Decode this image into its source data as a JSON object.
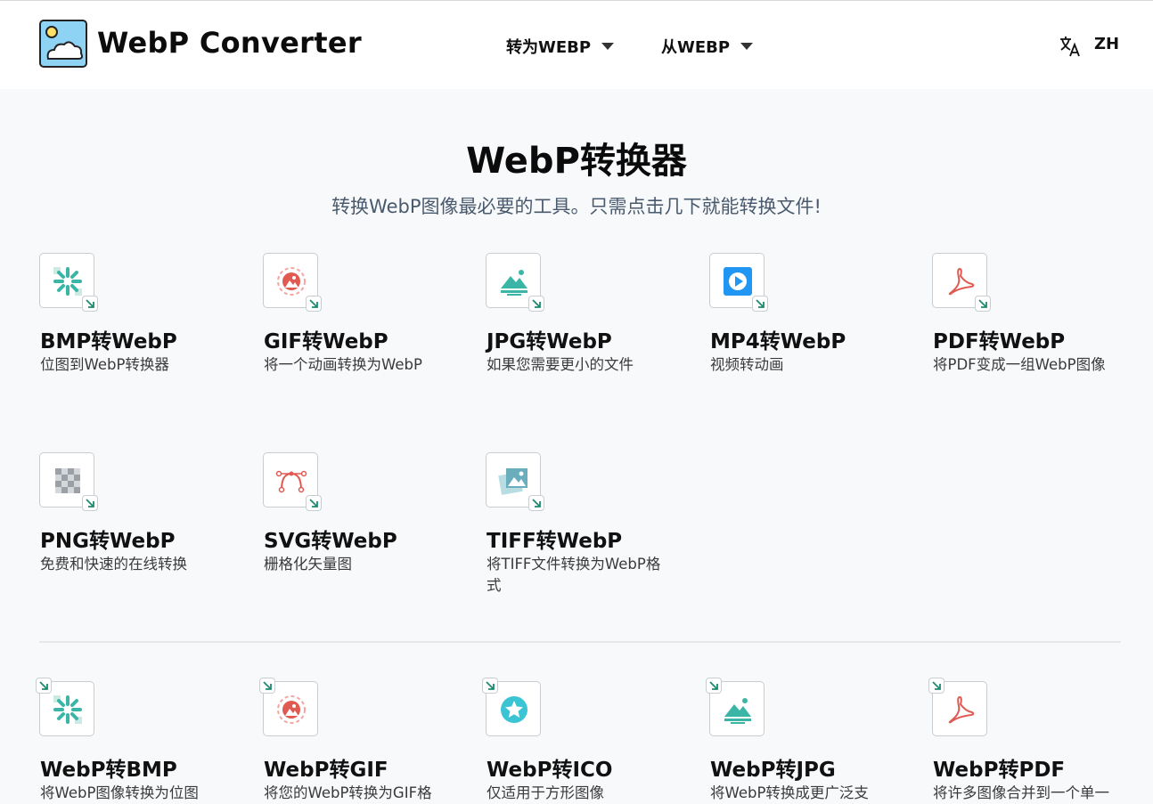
{
  "header": {
    "brand": "WebP Converter",
    "nav": [
      {
        "label": "转为WEBP"
      },
      {
        "label": "从WEBP"
      }
    ],
    "lang": "ZH"
  },
  "hero": {
    "title": "WebP转换器",
    "subtitle": "转换WebP图像最必要的工具。只需点击几下就能转换文件!"
  },
  "to_webp": [
    {
      "title": "BMP转WebP",
      "desc": "位图到WebP转换器",
      "icon": "bmp-icon"
    },
    {
      "title": "GIF转WebP",
      "desc": "将一个动画转换为WebP",
      "icon": "gif-icon"
    },
    {
      "title": "JPG转WebP",
      "desc": "如果您需要更小的文件",
      "icon": "jpg-icon"
    },
    {
      "title": "MP4转WebP",
      "desc": "视频转动画",
      "icon": "mp4-icon"
    },
    {
      "title": "PDF转WebP",
      "desc": "将PDF变成一组WebP图像",
      "icon": "pdf-icon"
    },
    {
      "title": "PNG转WebP",
      "desc": "免费和快速的在线转换",
      "icon": "png-icon"
    },
    {
      "title": "SVG转WebP",
      "desc": "栅格化矢量图",
      "icon": "svg-icon"
    },
    {
      "title": "TIFF转WebP",
      "desc": "将TIFF文件转换为WebP格式",
      "icon": "tiff-icon"
    }
  ],
  "from_webp": [
    {
      "title": "WebP转BMP",
      "desc": "将WebP图像转换为位图",
      "icon": "bmp-icon"
    },
    {
      "title": "WebP转GIF",
      "desc": "将您的WebP转换为GIF格",
      "icon": "gif-icon"
    },
    {
      "title": "WebP转ICO",
      "desc": "仅适用于方形图像",
      "icon": "ico-icon"
    },
    {
      "title": "WebP转JPG",
      "desc": "将WebP转换成更广泛支",
      "icon": "jpg-icon"
    },
    {
      "title": "WebP转PDF",
      "desc": "将许多图像合并到一个单一",
      "icon": "pdf-icon"
    }
  ],
  "colors": {
    "accent_green": "#1f8a70",
    "teal": "#3bb6a6",
    "red": "#e05a52",
    "blue": "#2196f3",
    "text": "#111111",
    "subtitle": "#4a5a6e"
  }
}
